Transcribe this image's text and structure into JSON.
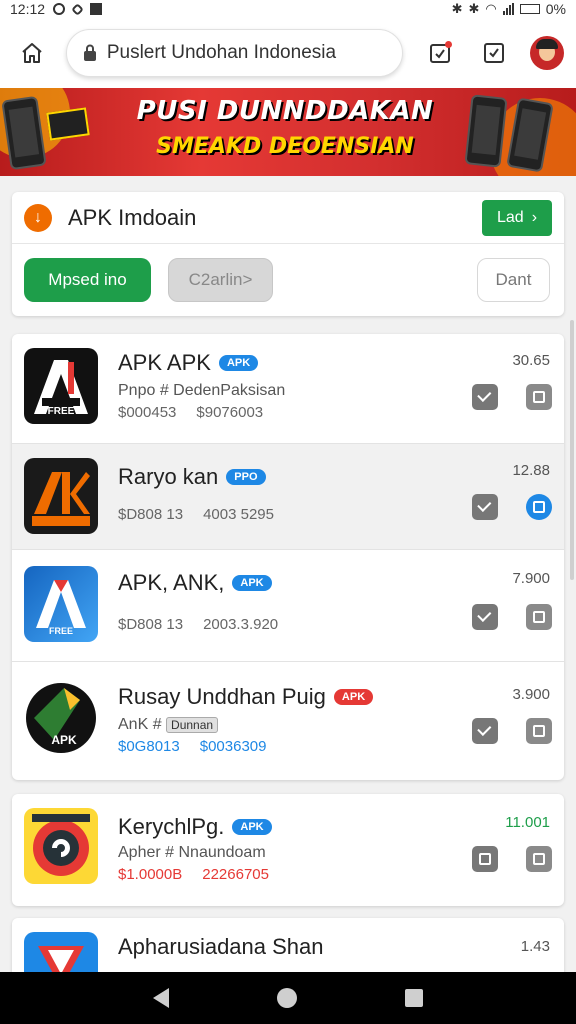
{
  "status_bar": {
    "time": "12:12",
    "battery": "0%"
  },
  "browser": {
    "url": "Puslert Undohan Indonesia"
  },
  "banner": {
    "title": "PUSI DUNNDDAKAN",
    "subtitle": "SMEAKD DEOENSIAN"
  },
  "category": {
    "title": "APK Imdoain",
    "load_label": "Lad",
    "pills": [
      "Mpsed ino",
      "C2arlin>",
      "Dant"
    ]
  },
  "apps": [
    {
      "name": "APK APK",
      "badge": "APK",
      "sub": "Pnpo # DedenPaksisan",
      "meta": [
        "$000453",
        "$9076003"
      ],
      "side": "30.65",
      "icon": "apk-a-icon"
    },
    {
      "name": "Raryo kan",
      "badge": "PPO",
      "sub": "",
      "meta": [
        "$D808 13",
        "4003 5295"
      ],
      "side": "12.88",
      "icon": "apk-orange-icon"
    },
    {
      "name": "APK, ANK,",
      "badge": "APK",
      "sub": "",
      "meta": [
        "$D808 13",
        "2003.3.920"
      ],
      "side": "7.900",
      "icon": "apk-blue-icon"
    },
    {
      "name": "Rusay Unddhan Puig",
      "badge": "APK",
      "sub": "AnK # ",
      "sub_badge": "Dunnan",
      "meta": [
        "$0G8013",
        "$0036309"
      ],
      "side": "3.900",
      "icon": "apk-green-icon"
    },
    {
      "name": "KerychlPg.",
      "badge": "APK",
      "sub": "Apher # Nnaundoam",
      "meta": [
        "$1.0000B",
        "22266705"
      ],
      "side": "11.001",
      "icon": "apk-ring-icon"
    },
    {
      "name": "Apharusiadana Shan",
      "side": "1.43",
      "icon": "apk-red-icon"
    }
  ]
}
